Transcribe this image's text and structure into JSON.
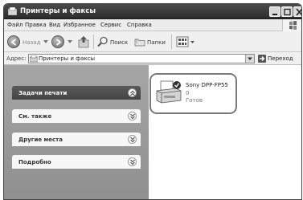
{
  "window": {
    "title": "Принтеры и факсы"
  },
  "menu": [
    "Файл",
    "Правка",
    "Вид",
    "Избранное",
    "Сервис",
    "Справка"
  ],
  "toolbar": {
    "back_label": "Назад",
    "search_label": "Поиск",
    "folders_label": "Папки"
  },
  "address": {
    "label": "Адрес:",
    "value": "Принтеры и факсы",
    "go_label": "Переход"
  },
  "sidebar": {
    "panels": [
      {
        "label": "Задачи печати",
        "expanded": true
      },
      {
        "label": "См. также",
        "expanded": false
      },
      {
        "label": "Другие места",
        "expanded": false
      },
      {
        "label": "Подробно",
        "expanded": false
      }
    ]
  },
  "printer": {
    "name": "Sony DPP-FP55",
    "jobs": "0",
    "status": "Готов",
    "is_default": true
  },
  "colors": {
    "titlebar": "#3a3a3a",
    "sidebar": "#9b9b9b",
    "highlight_border": "#7a7a7a"
  }
}
